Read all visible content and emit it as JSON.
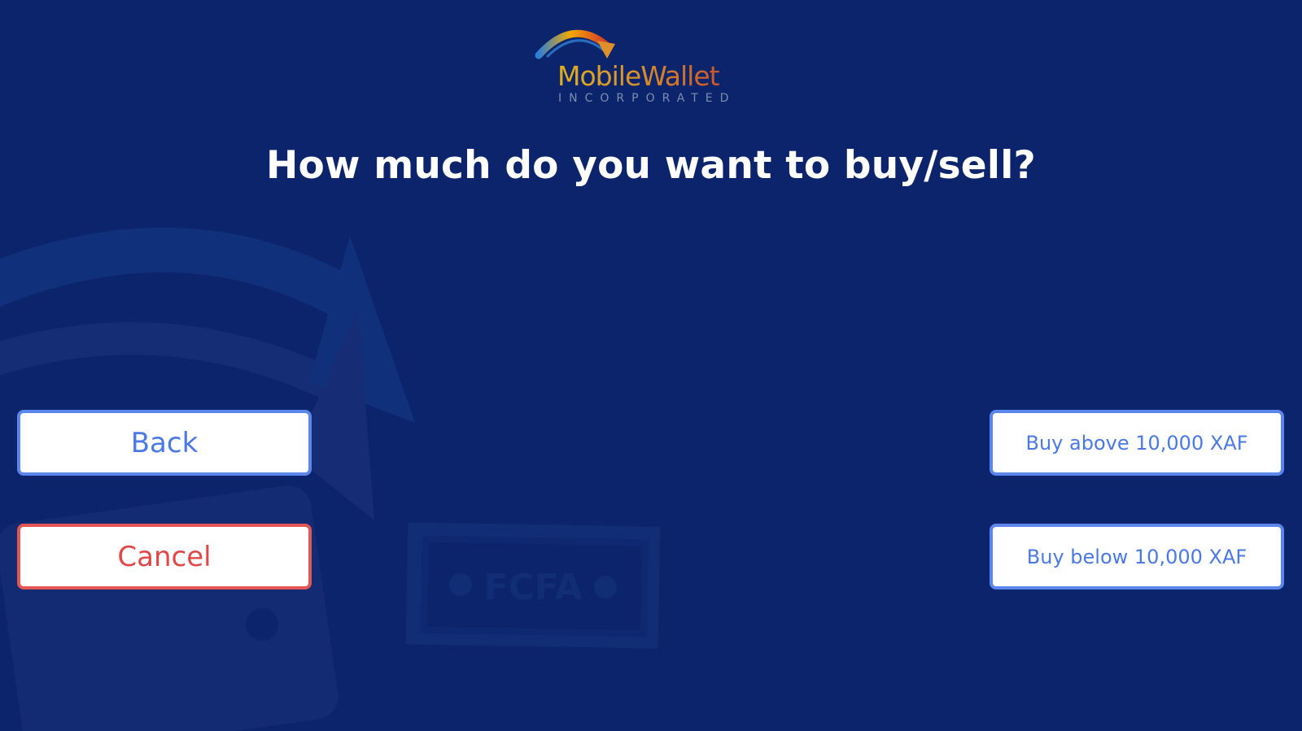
{
  "logo": {
    "name": "MobileWallet",
    "subtitle": "INCORPORATED"
  },
  "prompt": {
    "question": "How much do you want to buy/sell?"
  },
  "buttons": {
    "back": "Back",
    "cancel": "Cancel",
    "buy_above": "Buy above 10,000 XAF",
    "buy_below": "Buy below 10,000 XAF"
  },
  "background": {
    "banknote_text": "FCFA"
  },
  "colors": {
    "background": "#0c246b",
    "primary_button": "#4a79e3",
    "cancel_button": "#e04848"
  }
}
